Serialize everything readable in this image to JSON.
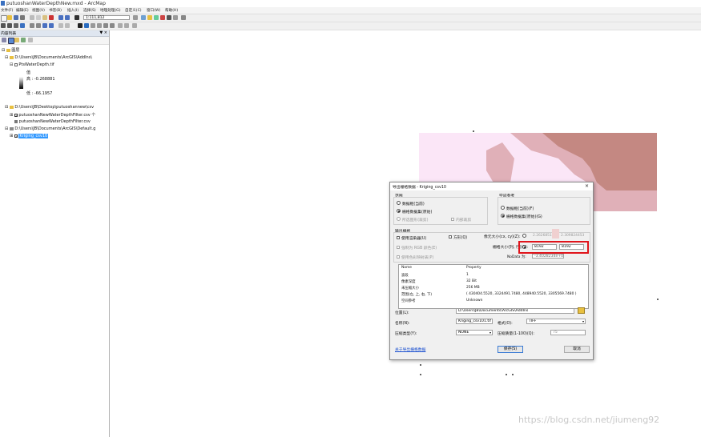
{
  "window": {
    "title": "putuoshanWaterDepthNew.mxd - ArcMap"
  },
  "menus": [
    "文件(F)",
    "编辑(E)",
    "视图(V)",
    "书签(B)",
    "插入(I)",
    "选择(S)",
    "地理处理(G)",
    "自定义(C)",
    "窗口(W)",
    "帮助(H)"
  ],
  "toolbar": {
    "scale": "1:111,812"
  },
  "toc": {
    "title": "内容列表",
    "pin": "▼ ×",
    "layers_label": "图层",
    "items": [
      {
        "label": "D:\\Users\\JB\\Documents\\ArcGIS\\AddIns\\"
      },
      {
        "label": "PtsWaterDepth.tif"
      },
      {
        "label": "值"
      },
      {
        "label": "高 : -0.268881"
      },
      {
        "label": "低 : -66.1957"
      },
      {
        "label": "D:\\Users\\JB\\Desktop\\putuoshannew\\csv"
      },
      {
        "label": "putuoshanNewWaterDepthFilter.csv 个"
      },
      {
        "label": "putuoshanNewWaterDepthFilter.csv"
      },
      {
        "label": "D:\\Users\\JB\\Documents\\ArcGIS\\Default.g"
      },
      {
        "label": "Kriging_csv10"
      }
    ]
  },
  "dialog": {
    "title": "导出栅格数据 - Kriging_csv10",
    "close": "×",
    "extent": {
      "label": "范围",
      "options": [
        "数据框(当前)",
        "栅格数据集(原始)",
        "所选图形(裁剪)"
      ],
      "internal": "内部裁剪"
    },
    "spatial_ref": {
      "label": "空间参考",
      "options": [
        "数据框(当前)(F)",
        "栅格数据集(原始)(G)"
      ]
    },
    "output": {
      "label": "输出栅格",
      "use_renderer": "使用渲染器(U)",
      "square": "方形(Q)",
      "force_rgb": "强制为 RGB 颜色(E)",
      "use_colormap": "使用色彩映射表(P)",
      "cell_size_label": "像元大小(cx, cy)(Z):",
      "cell_size_x": "2.262685155",
      "cell_size_y": "2.309824453",
      "raster_size_label": "栅格大小(列, 行)(E):",
      "cols": "8192",
      "rows": "8192",
      "nodata_label": "NoData 为:",
      "nodata_value": "-3.4028234e+0"
    },
    "properties": {
      "headers": [
        "Name",
        "Property"
      ],
      "rows": [
        [
          "波段",
          "1"
        ],
        [
          "像素深度",
          "32 Bit"
        ],
        [
          "未压缩大小",
          "256 MB"
        ],
        [
          "范围(左, 上, 右, 下)",
          "( 430404.5520, 3324491.7480, 448940.5520, 3305569.7480 )"
        ],
        [
          "空间参考",
          "Unknown"
        ]
      ]
    },
    "location_label": "位置(L):",
    "location_value": "D:\\Users\\JB\\Documents\\ArcGIS\\AddIns",
    "name_label": "名称(N):",
    "name_value": "Kriging_csv101.tif",
    "format_label": "格式(O):",
    "format_value": "TIFF",
    "compression_label": "压缩类型(Y):",
    "compression_value": "NONE",
    "quality_label": "压缩质量(1-100)(Q):",
    "quality_value": "75",
    "about_link": "关于导出栅格数据",
    "save": "保存(S)",
    "cancel": "取消"
  },
  "watermark": "https://blog.csdn.net/jiumeng92",
  "colors": {
    "accent_red": "#e0141b",
    "selection": "#3399ff",
    "raster_pink": "#fbe6f7",
    "raster_rose": "#e0b0b8",
    "raster_brown": "#c48882"
  }
}
